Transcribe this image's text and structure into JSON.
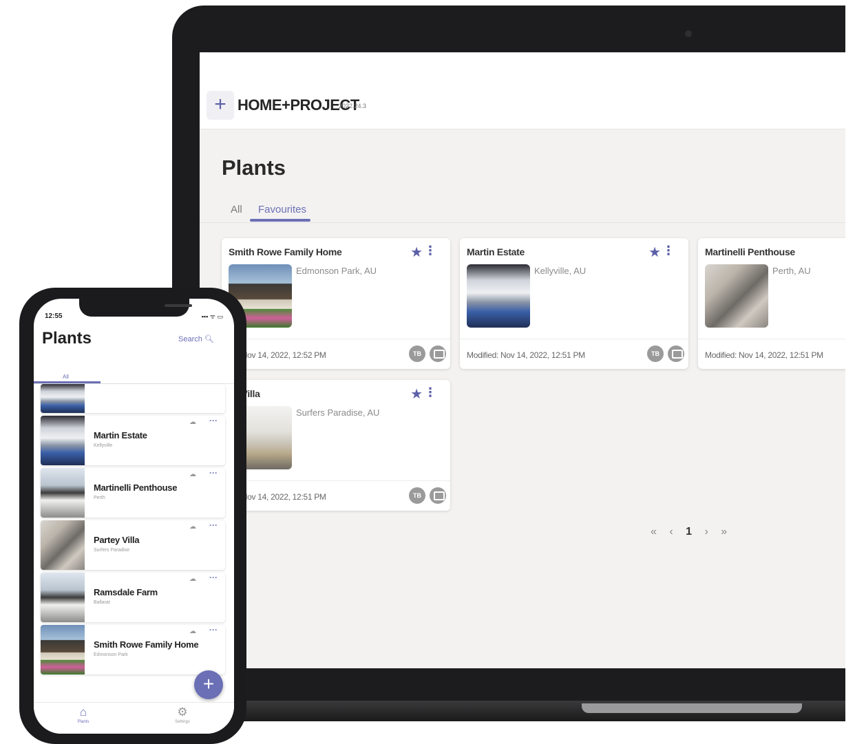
{
  "laptop": {
    "app_name": "HOME+PROJECT",
    "version": "2022.24.3",
    "plus_icon": "+",
    "page_title": "Plants",
    "tabs": [
      {
        "label": "All",
        "active": false
      },
      {
        "label": "Favourites",
        "active": true
      }
    ],
    "cards": [
      {
        "title": "Smith Rowe Family Home",
        "location": "Edmonson Park, AU",
        "modified": "ed: Nov 14, 2022, 12:52 PM",
        "badge": "TB",
        "favourite": true
      },
      {
        "title": "Martin Estate",
        "location": "Kellyville, AU",
        "modified": "Modified: Nov 14, 2022, 12:51 PM",
        "badge": "TB",
        "favourite": true
      },
      {
        "title": "Martinelli Penthouse",
        "location": "Perth, AU",
        "modified": "Modified: Nov 14, 2022, 12:51 PM",
        "badge": "TB",
        "favourite": true
      },
      {
        "title": "ey Villa",
        "location": "Surfers Paradise, AU",
        "modified": "ed: Nov 14, 2022, 12:51 PM",
        "badge": "TB",
        "favourite": true
      }
    ],
    "pagination": {
      "first": "«",
      "prev": "‹",
      "current": "1",
      "next": "›",
      "last": "»"
    },
    "accent_color": "#6b6fb5"
  },
  "phone": {
    "status_time": "12:55",
    "status_icons": "▪▪▪ ᯤ ▭",
    "title": "Plants",
    "search_label": "Search",
    "tab_all": "All",
    "items": [
      {
        "name": "Martin Estate",
        "location": "Kellyville"
      },
      {
        "name": "Martinelli Penthouse",
        "location": "Perth"
      },
      {
        "name": "Partey Villa",
        "location": "Surfers Paradise"
      },
      {
        "name": "Ramsdale Farm",
        "location": "Ballarat"
      },
      {
        "name": "Smith Rowe Family Home",
        "location": "Edmonson Park"
      }
    ],
    "fab_icon": "+",
    "nav": {
      "plants": "Plants",
      "settings": "Settings"
    }
  }
}
